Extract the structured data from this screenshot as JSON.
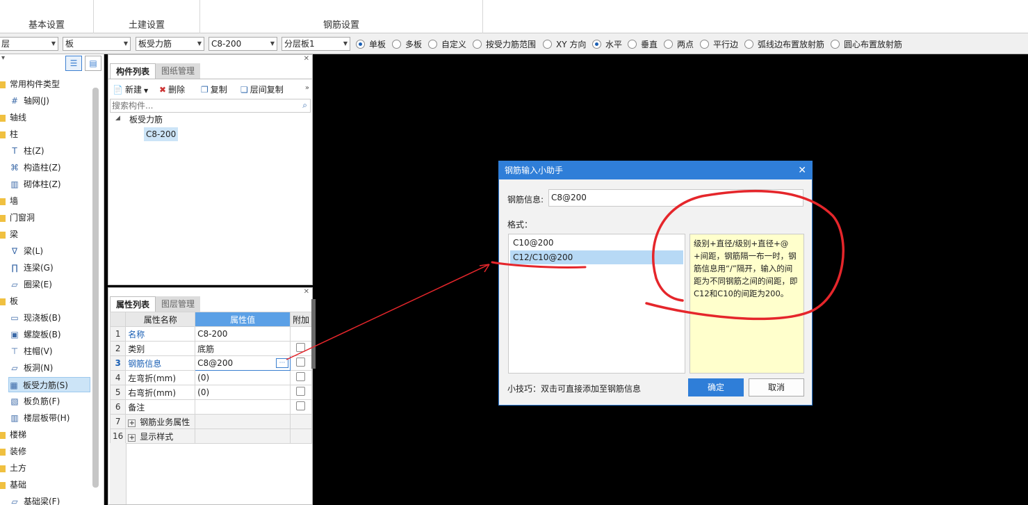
{
  "ribbon": {
    "groups": [
      "基本设置",
      "土建设置",
      "钢筋设置"
    ]
  },
  "toolbar": {
    "combos": [
      "层",
      "板",
      "板受力筋",
      "C8-200",
      "分层板1"
    ],
    "radios": [
      {
        "label": "单板",
        "on": true
      },
      {
        "label": "多板",
        "on": false
      },
      {
        "label": "自定义",
        "on": false
      },
      {
        "label": "按受力筋范围",
        "on": false
      },
      {
        "label": "XY 方向",
        "on": false
      },
      {
        "label": "水平",
        "on": true
      },
      {
        "label": "垂直",
        "on": false
      },
      {
        "label": "两点",
        "on": false
      },
      {
        "label": "平行边",
        "on": false
      },
      {
        "label": "弧线边布置放射筋",
        "on": false
      },
      {
        "label": "圆心布置放射筋",
        "on": false
      }
    ]
  },
  "leftnav": {
    "items": [
      {
        "label": "常用构件类型",
        "kind": "folder",
        "sel": false
      },
      {
        "label": "轴网(J)",
        "kind": "child",
        "icon": "#",
        "sel": false
      },
      {
        "label": "轴线",
        "kind": "folder",
        "sel": false
      },
      {
        "label": "柱",
        "kind": "folder",
        "sel": false
      },
      {
        "label": "柱(Z)",
        "kind": "child",
        "icon": "T",
        "sel": false
      },
      {
        "label": "构造柱(Z)",
        "kind": "child",
        "icon": "⌘",
        "sel": false
      },
      {
        "label": "砌体柱(Z)",
        "kind": "child",
        "icon": "▥",
        "sel": false
      },
      {
        "label": "墙",
        "kind": "folder",
        "sel": false
      },
      {
        "label": "门窗洞",
        "kind": "folder",
        "sel": false
      },
      {
        "label": "梁",
        "kind": "folder",
        "sel": false
      },
      {
        "label": "梁(L)",
        "kind": "child",
        "icon": "∇",
        "sel": false
      },
      {
        "label": "连梁(G)",
        "kind": "child",
        "icon": "∏",
        "sel": false
      },
      {
        "label": "圈梁(E)",
        "kind": "child",
        "icon": "▱",
        "sel": false
      },
      {
        "label": "板",
        "kind": "folder",
        "sel": false
      },
      {
        "label": "现浇板(B)",
        "kind": "child",
        "icon": "▭",
        "sel": false
      },
      {
        "label": "螺旋板(B)",
        "kind": "child",
        "icon": "▣",
        "sel": false
      },
      {
        "label": "柱帽(V)",
        "kind": "child",
        "icon": "⊤",
        "sel": false
      },
      {
        "label": "板洞(N)",
        "kind": "child",
        "icon": "▱",
        "sel": false
      },
      {
        "label": "板受力筋(S)",
        "kind": "child",
        "icon": "▦",
        "sel": true
      },
      {
        "label": "板负筋(F)",
        "kind": "child",
        "icon": "▧",
        "sel": false
      },
      {
        "label": "楼层板带(H)",
        "kind": "child",
        "icon": "▥",
        "sel": false
      },
      {
        "label": "楼梯",
        "kind": "folder",
        "sel": false
      },
      {
        "label": "装修",
        "kind": "folder",
        "sel": false
      },
      {
        "label": "土方",
        "kind": "folder",
        "sel": false
      },
      {
        "label": "基础",
        "kind": "folder",
        "sel": false
      },
      {
        "label": "基础梁(F)",
        "kind": "child",
        "icon": "▱",
        "sel": false
      }
    ]
  },
  "comp_panel": {
    "tab_active": "构件列表",
    "tab_inactive": "图纸管理",
    "btn_new": "新建",
    "btn_delete": "删除",
    "btn_copy": "复制",
    "btn_floor_copy": "层间复制",
    "search_placeholder": "搜索构件...",
    "tree_root": "板受力筋",
    "tree_child": "C8-200"
  },
  "prop_panel": {
    "tab_active": "属性列表",
    "tab_inactive": "图层管理",
    "col_name": "属性名称",
    "col_value": "属性值",
    "col_extra": "附加",
    "rows": [
      {
        "num": "1",
        "name": "名称",
        "value": "C8-200",
        "blue": true,
        "chk": false
      },
      {
        "num": "2",
        "name": "类别",
        "value": "底筋",
        "blue": false,
        "chk": true
      },
      {
        "num": "3",
        "name": "钢筋信息",
        "value": "C8@200",
        "blue": true,
        "chk": true
      },
      {
        "num": "4",
        "name": "左弯折(mm)",
        "value": "(0)",
        "blue": false,
        "chk": true
      },
      {
        "num": "5",
        "name": "右弯折(mm)",
        "value": "(0)",
        "blue": false,
        "chk": true
      },
      {
        "num": "6",
        "name": "备注",
        "value": "",
        "blue": false,
        "chk": true
      },
      {
        "num": "7",
        "name": "钢筋业务属性",
        "value": "",
        "blue": false,
        "chk": false,
        "expand": true
      },
      {
        "num": "16",
        "name": "显示样式",
        "value": "",
        "blue": false,
        "chk": false,
        "expand": true
      }
    ]
  },
  "dialog": {
    "title": "钢筋输入小助手",
    "info_label": "钢筋信息:",
    "info_value": "C8@200",
    "format_label": "格式：",
    "formats": [
      "C10@200",
      "C12/C10@200"
    ],
    "desc": "级别+直径/级别+直径+@+间距，钢筋隔一布一时，钢筋信息用“/”隔开，输入的间距为不同钢筋之间的间距，即C12和C10的间距为200。",
    "tip": "小技巧：双击可直接添加至钢筋信息",
    "ok": "确定",
    "cancel": "取消"
  },
  "colors": {
    "accent": "#2f7ed8",
    "annotation": "#e5262b",
    "desc_bg": "#ffffcc",
    "selection": "#cce4f7"
  }
}
